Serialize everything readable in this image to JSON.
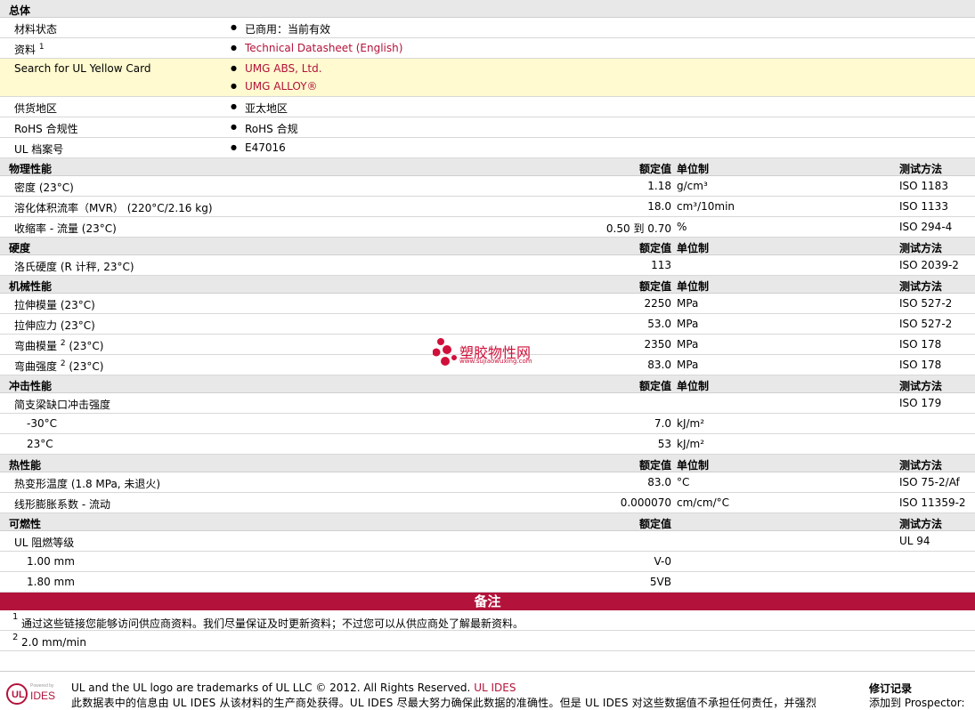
{
  "sections": {
    "general": "总体",
    "physical": "物理性能",
    "hardness": "硬度",
    "mechanical": "机械性能",
    "impact": "冲击性能",
    "thermal": "热性能",
    "flammability": "可燃性"
  },
  "headers": {
    "nominal": "额定值",
    "unit": "单位制",
    "method": "测试方法"
  },
  "general": {
    "status_label": "材料状态",
    "status_value": "已商用：当前有效",
    "resource_label": "资料",
    "resource_sup": "1",
    "resource_link": "Technical Datasheet (English)",
    "yellow_label": "Search for UL Yellow Card",
    "yellow_link1": "UMG ABS, Ltd.",
    "yellow_link2": "UMG ALLOY®",
    "region_label": "供货地区",
    "region_value": "亚太地区",
    "rohs_label": "RoHS 合规性",
    "rohs_value": "RoHS 合规",
    "ul_label": "UL 档案号",
    "ul_value": "E47016"
  },
  "physical": [
    {
      "label": "密度  (23°C)",
      "value": "1.18",
      "unit": "g/cm³",
      "method": "ISO 1183"
    },
    {
      "label": "溶化体积流率（MVR）  (220°C/2.16 kg)",
      "value": "18.0",
      "unit": "cm³/10min",
      "method": "ISO 1133"
    },
    {
      "label": "收缩率  - 流量  (23°C)",
      "value": "0.50 到  0.70",
      "unit": "%",
      "method": "ISO 294-4"
    }
  ],
  "hardness": [
    {
      "label": "洛氏硬度  (R 计秤, 23°C)",
      "value": "113",
      "unit": "",
      "method": "ISO 2039-2"
    }
  ],
  "mechanical": [
    {
      "label": "拉伸模量  (23°C)",
      "sup": "",
      "label_tail": "",
      "value": "2250",
      "unit": "MPa",
      "method": "ISO 527-2"
    },
    {
      "label": "拉伸应力  (23°C)",
      "sup": "",
      "label_tail": "",
      "value": "53.0",
      "unit": "MPa",
      "method": "ISO 527-2"
    },
    {
      "label": "弯曲模量 ",
      "sup": "2",
      "label_tail": " (23°C)",
      "value": "2350",
      "unit": "MPa",
      "method": "ISO 178"
    },
    {
      "label": "弯曲强度 ",
      "sup": "2",
      "label_tail": " (23°C)",
      "value": "83.0",
      "unit": "MPa",
      "method": "ISO 178"
    }
  ],
  "impact": {
    "label": "简支梁缺口冲击强度",
    "method": "ISO 179",
    "rows": [
      {
        "label": "-30°C",
        "value": "7.0",
        "unit": "kJ/m²"
      },
      {
        "label": "23°C",
        "value": "53",
        "unit": "kJ/m²"
      }
    ]
  },
  "thermal": [
    {
      "label": "热变形温度  (1.8 MPa, 未退火)",
      "value": "83.0",
      "unit": "°C",
      "method": "ISO 75-2/Af"
    },
    {
      "label": "线形膨胀系数  - 流动",
      "value": "0.000070",
      "unit": "cm/cm/°C",
      "method": "ISO 11359-2"
    }
  ],
  "flammability": {
    "label": "UL 阻燃等级",
    "method": "UL 94",
    "rows": [
      {
        "label": "1.00 mm",
        "value": "V-0"
      },
      {
        "label": "1.80 mm",
        "value": "5VB"
      }
    ]
  },
  "notes": {
    "title": "备注",
    "items": [
      {
        "n": "1",
        "text": "通过这些链接您能够访问供应商资料。我们尽量保证及时更新资料；不过您可以从供应商处了解最新资料。"
      },
      {
        "n": "2",
        "text": "2.0 mm/min"
      }
    ]
  },
  "footer": {
    "logo_powered": "Powered by",
    "logo_text": "IDES",
    "line1": "UL and the UL logo are trademarks of UL LLC © 2012. All Rights Reserved.",
    "line1_link": "UL IDES",
    "line2": "此数据表中的信息由  UL IDES 从该材料的生产商处获得。UL IDES 尽最大努力确保此数据的准确性。但是  UL IDES 对这些数据值不承担任何责任，并强烈",
    "rev_title": "修订记录",
    "rev_text": "添加到  Prospector:"
  },
  "watermark": {
    "cn": "塑胶物性网",
    "en": "www.sujiaowuxing.com"
  },
  "colors": {
    "accent": "#b3123a",
    "highlight": "#fffad0",
    "section_bg": "#e8e8e8"
  }
}
